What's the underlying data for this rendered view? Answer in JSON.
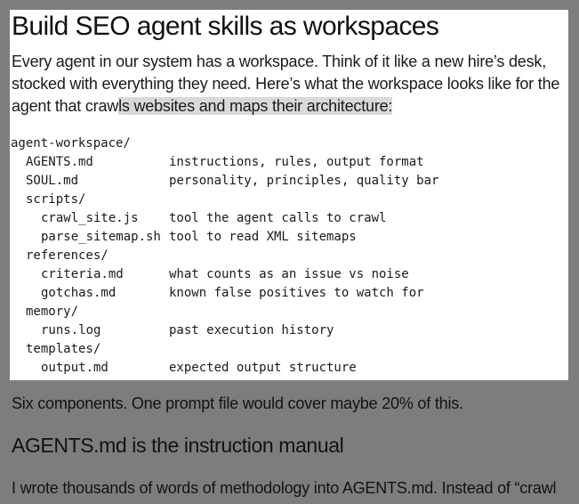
{
  "card": {
    "title": "Build SEO agent skills as workspaces",
    "intro_before_highlight": "Every agent in our system has a workspace. Think of it like a new hire’s desk, stocked with everything they need. Here’s what the workspace looks like for the agent that craw",
    "intro_highlight": "ls websites and maps their architecture:",
    "tree": [
      {
        "name": "agent-workspace/",
        "desc": ""
      },
      {
        "name": "AGENTS.md",
        "desc": "instructions, rules, output format"
      },
      {
        "name": "SOUL.md",
        "desc": "personality, principles, quality bar"
      },
      {
        "name": "scripts/",
        "desc": ""
      },
      {
        "name": "crawl_site.js",
        "desc": "tool the agent calls to crawl"
      },
      {
        "name": "parse_sitemap.sh",
        "desc": "tool to read XML sitemaps"
      },
      {
        "name": "references/",
        "desc": ""
      },
      {
        "name": "criteria.md",
        "desc": "what counts as an issue vs noise"
      },
      {
        "name": "gotchas.md",
        "desc": "known false positives to watch for"
      },
      {
        "name": "memory/",
        "desc": ""
      },
      {
        "name": "runs.log",
        "desc": "past execution history"
      },
      {
        "name": "templates/",
        "desc": ""
      },
      {
        "name": "output.md",
        "desc": "expected output structure"
      }
    ]
  },
  "below": {
    "paragraph1": "Six components. One prompt file would cover maybe 20% of this.",
    "subheading": "AGENTS.md is the instruction manual",
    "paragraph2": "I wrote thousands of words of methodology into AGENTS.md.  Instead of “crawl"
  },
  "colors": {
    "backdrop": "#7d7d7d",
    "card_background": "#ffffff",
    "text_highlight": "#d9d9d9"
  }
}
